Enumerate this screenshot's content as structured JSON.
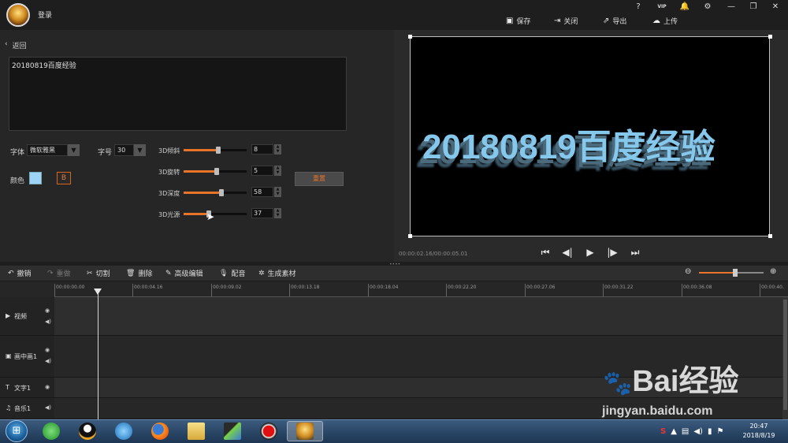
{
  "titlebar": {
    "login": "登录",
    "window_buttons": [
      "?",
      "VIP",
      "🔔",
      "⚙",
      "—",
      "❐",
      "✕"
    ],
    "actions": [
      {
        "icon": "save-icon",
        "label": "保存"
      },
      {
        "icon": "close-project-icon",
        "label": "关闭"
      },
      {
        "icon": "export-icon",
        "label": "导出"
      },
      {
        "icon": "upload-icon",
        "label": "上传"
      }
    ]
  },
  "editor": {
    "back_label": "返回",
    "text_value": "20180819百度经验",
    "font_label": "字体",
    "font_value": "微软雅黑",
    "size_label": "字号",
    "size_value": "30",
    "color_label": "颜色",
    "color_value": "#9fd3f5",
    "bold_label": "B",
    "sliders": [
      {
        "label": "3D倾斜",
        "value": "8",
        "fraction": 0.55
      },
      {
        "label": "3D旋转",
        "value": "5",
        "fraction": 0.53
      },
      {
        "label": "3D深度",
        "value": "58",
        "fraction": 0.6
      },
      {
        "label": "3D光源",
        "value": "37",
        "fraction": 0.4
      }
    ],
    "reset_label": "重置"
  },
  "preview": {
    "text": "20180819百度经验",
    "timecode": "00:00:02.16/00:00:05.01"
  },
  "toolbar": {
    "undo": "撤销",
    "redo": "重做",
    "cut": "切割",
    "delete": "删除",
    "advanced_edit": "高级编辑",
    "dub": "配音",
    "generate": "生成素材",
    "zoom_level": 0.55
  },
  "ruler": {
    "ticks": [
      "00:00:00.00",
      "00:00:04.16",
      "00:00:09.02",
      "00:00:13.18",
      "00:00:18.04",
      "00:00:22.20",
      "00:00:27.06",
      "00:00:31.22",
      "00:00:36.08",
      "00:00:40."
    ]
  },
  "tracks": [
    {
      "name": "视频",
      "icon": "video-track-icon"
    },
    {
      "name": "画中画1",
      "icon": "pip-track-icon"
    },
    {
      "name": "文字1",
      "icon": "text-track-icon"
    },
    {
      "name": "音乐1",
      "icon": "music-track-icon"
    }
  ],
  "watermark": {
    "brand": "Bai经验",
    "url": "jingyan.baidu.com"
  },
  "taskbar": {
    "time": "20:47",
    "date": "2018/8/19"
  },
  "colors": {
    "accent": "#e8742a",
    "preview_text": "#86c7ec"
  }
}
